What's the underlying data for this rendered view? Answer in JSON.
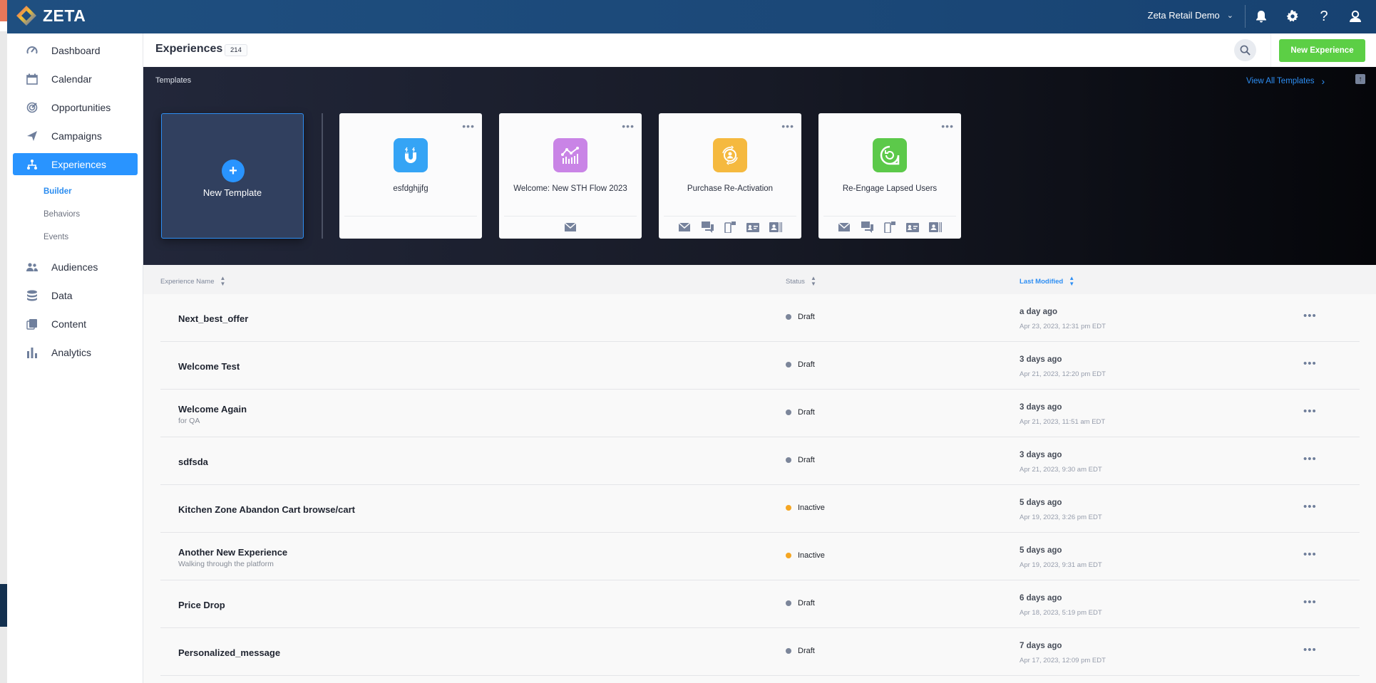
{
  "topbar": {
    "brand": "ZETA",
    "account_name": "Zeta Retail Demo",
    "icons": [
      "bell-icon",
      "gear-icon",
      "help-icon",
      "user-icon"
    ]
  },
  "sidebar": {
    "items": [
      {
        "label": "Dashboard",
        "icon": "speedometer-icon"
      },
      {
        "label": "Calendar",
        "icon": "calendar-icon"
      },
      {
        "label": "Opportunities",
        "icon": "target-icon"
      },
      {
        "label": "Campaigns",
        "icon": "paper-plane-icon"
      },
      {
        "label": "Experiences",
        "icon": "hierarchy-icon",
        "active": true
      },
      {
        "label": "Audiences",
        "icon": "people-icon"
      },
      {
        "label": "Data",
        "icon": "database-icon"
      },
      {
        "label": "Content",
        "icon": "documents-icon"
      },
      {
        "label": "Analytics",
        "icon": "bar-chart-icon"
      }
    ],
    "sub_items": [
      {
        "label": "Builder",
        "active": true
      },
      {
        "label": "Behaviors"
      },
      {
        "label": "Events"
      }
    ]
  },
  "header": {
    "title": "Experiences",
    "count": "214",
    "new_button": "New Experience"
  },
  "templates": {
    "label": "Templates",
    "view_all": "View All Templates",
    "new_template": "New Template",
    "cards": [
      {
        "name": "esfdghjjfg",
        "icon": "magnet-icon",
        "color": "#35a4f5",
        "channels": []
      },
      {
        "name": "Welcome: New STH Flow 2023",
        "icon": "chart-growth-icon",
        "color": "#c984e6",
        "channels": [
          "email-icon"
        ]
      },
      {
        "name": "Purchase Re-Activation",
        "icon": "user-cycle-icon",
        "color": "#f5b93f",
        "channels": [
          "email-icon",
          "chat-icon",
          "mobile-push-icon",
          "id-card-icon",
          "contact-card-icon"
        ]
      },
      {
        "name": "Re-Engage Lapsed Users",
        "icon": "refresh-bubble-icon",
        "color": "#5cc94a",
        "channels": [
          "email-icon",
          "chat-icon",
          "mobile-push-icon",
          "id-card-icon",
          "contact-card-icon"
        ]
      }
    ]
  },
  "table": {
    "columns": {
      "name": "Experience Name",
      "status": "Status",
      "modified": "Last Modified"
    },
    "status_colors": {
      "Draft": "#7c869a",
      "Inactive": "#f5a623"
    },
    "rows": [
      {
        "name": "Next_best_offer",
        "desc": "",
        "status": "Draft",
        "relative": "a day ago",
        "absolute": "Apr 23, 2023, 12:31 pm EDT"
      },
      {
        "name": "Welcome Test",
        "desc": "",
        "status": "Draft",
        "relative": "3 days ago",
        "absolute": "Apr 21, 2023, 12:20 pm EDT"
      },
      {
        "name": "Welcome Again",
        "desc": "for QA",
        "status": "Draft",
        "relative": "3 days ago",
        "absolute": "Apr 21, 2023, 11:51 am EDT"
      },
      {
        "name": "sdfsda",
        "desc": "",
        "status": "Draft",
        "relative": "3 days ago",
        "absolute": "Apr 21, 2023, 9:30 am EDT"
      },
      {
        "name": "Kitchen Zone Abandon Cart browse/cart",
        "desc": "",
        "status": "Inactive",
        "relative": "5 days ago",
        "absolute": "Apr 19, 2023, 3:26 pm EDT"
      },
      {
        "name": "Another New Experience",
        "desc": "Walking through the platform",
        "status": "Inactive",
        "relative": "5 days ago",
        "absolute": "Apr 19, 2023, 9:31 am EDT"
      },
      {
        "name": "Price Drop",
        "desc": "",
        "status": "Draft",
        "relative": "6 days ago",
        "absolute": "Apr 18, 2023, 5:19 pm EDT"
      },
      {
        "name": "Personalized_message",
        "desc": "",
        "status": "Draft",
        "relative": "7 days ago",
        "absolute": "Apr 17, 2023, 12:09 pm EDT"
      }
    ]
  }
}
